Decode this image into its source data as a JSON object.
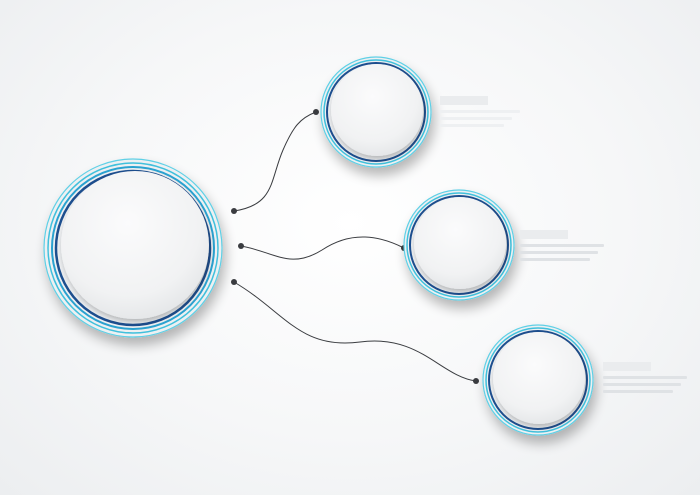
{
  "diagram": {
    "type": "infographic-circles",
    "colors": {
      "background": "#f4f5f6",
      "ring_light": "#3fc0dc",
      "ring_mid": "#2aa2d0",
      "ring_dark": "#1f4f8f",
      "connector": "#3a3c40",
      "disc": "#f3f4f5"
    },
    "nodes": [
      {
        "id": "main",
        "label": ""
      },
      {
        "id": "option-1",
        "label": ""
      },
      {
        "id": "option-2",
        "label": ""
      },
      {
        "id": "option-3",
        "label": ""
      }
    ],
    "connections": [
      {
        "from": "main",
        "to": "option-1"
      },
      {
        "from": "main",
        "to": "option-2"
      },
      {
        "from": "main",
        "to": "option-3"
      }
    ]
  }
}
